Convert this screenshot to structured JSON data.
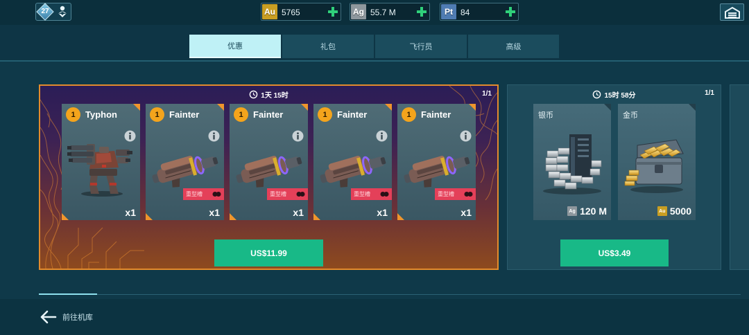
{
  "header": {
    "level": "27",
    "currencies": [
      {
        "code": "Au",
        "value": "5765",
        "color": "#c99e22",
        "icon": "gold-currency-icon"
      },
      {
        "code": "Ag",
        "value": "55.7 M",
        "color": "#8e979d",
        "icon": "silver-currency-icon"
      },
      {
        "code": "Pt",
        "value": "84",
        "color": "#4f7cb3",
        "icon": "platinum-currency-icon"
      }
    ],
    "icons": {
      "profile": "profile-download-icon",
      "garage": "garage-icon",
      "add": "plus-icon"
    }
  },
  "tabs": [
    {
      "label": "优惠",
      "active": true
    },
    {
      "label": "礼包",
      "active": false
    },
    {
      "label": "飞行员",
      "active": false
    },
    {
      "label": "高级",
      "active": false
    }
  ],
  "offers": [
    {
      "timer": "1天 15时",
      "count": "1/1",
      "price": "US$11.99",
      "items": [
        {
          "badge": "1",
          "name": "Typhon",
          "qty": "x1",
          "icon": "typhon-robot-icon"
        },
        {
          "badge": "1",
          "name": "Fainter",
          "qty": "x1",
          "tag": "重型槽",
          "icon": "fainter-weapon-icon"
        },
        {
          "badge": "1",
          "name": "Fainter",
          "qty": "x1",
          "tag": "重型槽",
          "icon": "fainter-weapon-icon"
        },
        {
          "badge": "1",
          "name": "Fainter",
          "qty": "x1",
          "tag": "重型槽",
          "icon": "fainter-weapon-icon"
        },
        {
          "badge": "1",
          "name": "Fainter",
          "qty": "x1",
          "tag": "重型槽",
          "icon": "fainter-weapon-icon"
        }
      ]
    },
    {
      "timer": "15时 58分",
      "count": "1/1",
      "price": "US$3.49",
      "items": [
        {
          "name": "银币",
          "currency": "Ag",
          "amount": "120 M",
          "icon": "silver-bars-icon"
        },
        {
          "name": "金币",
          "currency": "Au",
          "amount": "5000",
          "icon": "gold-chest-icon"
        }
      ]
    }
  ],
  "footer": {
    "back_label": "前往机库",
    "icon": "back-arrow-icon"
  },
  "colors": {
    "accent_orange": "#e38b2c",
    "buy_green": "#18b987",
    "tab_active": "#bff1f6",
    "tag_pink": "#e44059",
    "badge_orange": "#f4a41c"
  }
}
